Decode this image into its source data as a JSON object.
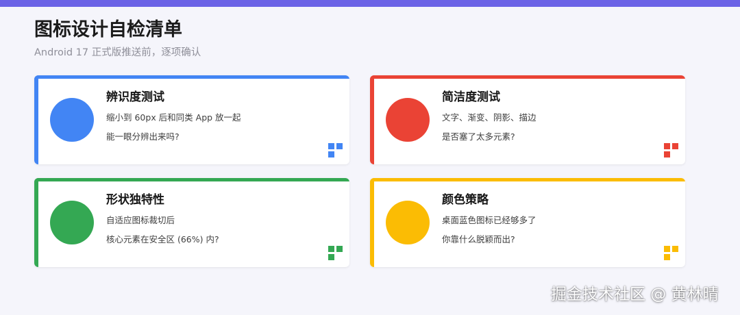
{
  "colors": {
    "top_bar": "#6b62e6",
    "background": "#f5f5fb",
    "blue": "#4285f4",
    "red": "#ea4335",
    "green": "#34a853",
    "yellow": "#fbbc04"
  },
  "header": {
    "title": "图标设计自检清单",
    "subtitle": "Android 17 正式版推送前，逐项确认"
  },
  "cards": [
    {
      "title": "辨识度测试",
      "line1": "缩小到 60px 后和同类 App 放一起",
      "line2": "能一眼分辨出来吗?",
      "color": "#4285f4",
      "icon": "grid-icon"
    },
    {
      "title": "简洁度测试",
      "line1": "文字、渐变、阴影、描边",
      "line2": "是否塞了太多元素?",
      "color": "#ea4335",
      "icon": "grid-icon"
    },
    {
      "title": "形状独特性",
      "line1": "自适应图标裁切后",
      "line2": "核心元素在安全区 (66%) 内?",
      "color": "#34a853",
      "icon": "grid-icon"
    },
    {
      "title": "颜色策略",
      "line1": "桌面蓝色图标已经够多了",
      "line2": "你靠什么脱颖而出?",
      "color": "#fbbc04",
      "icon": "grid-icon"
    }
  ],
  "watermark": "掘金技术社区 @ 黄林晴"
}
